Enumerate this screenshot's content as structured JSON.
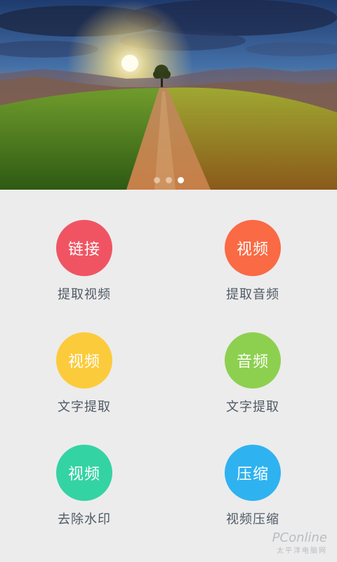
{
  "banner": {
    "image": "sunset-country-road",
    "slide_count": 3,
    "active_slide": 3
  },
  "tiles": [
    {
      "icon_text": "链接",
      "label": "提取视频",
      "color": "#f05462"
    },
    {
      "icon_text": "视频",
      "label": "提取音频",
      "color": "#fa6a44"
    },
    {
      "icon_text": "视频",
      "label": "文字提取",
      "color": "#fccb3b"
    },
    {
      "icon_text": "音频",
      "label": "文字提取",
      "color": "#8dd04f"
    },
    {
      "icon_text": "视频",
      "label": "去除水印",
      "color": "#34d3a3"
    },
    {
      "icon_text": "压缩",
      "label": "视频压缩",
      "color": "#2fb2f0"
    }
  ],
  "watermark": {
    "logo": "PConline",
    "sub": "太平洋电脑网"
  }
}
